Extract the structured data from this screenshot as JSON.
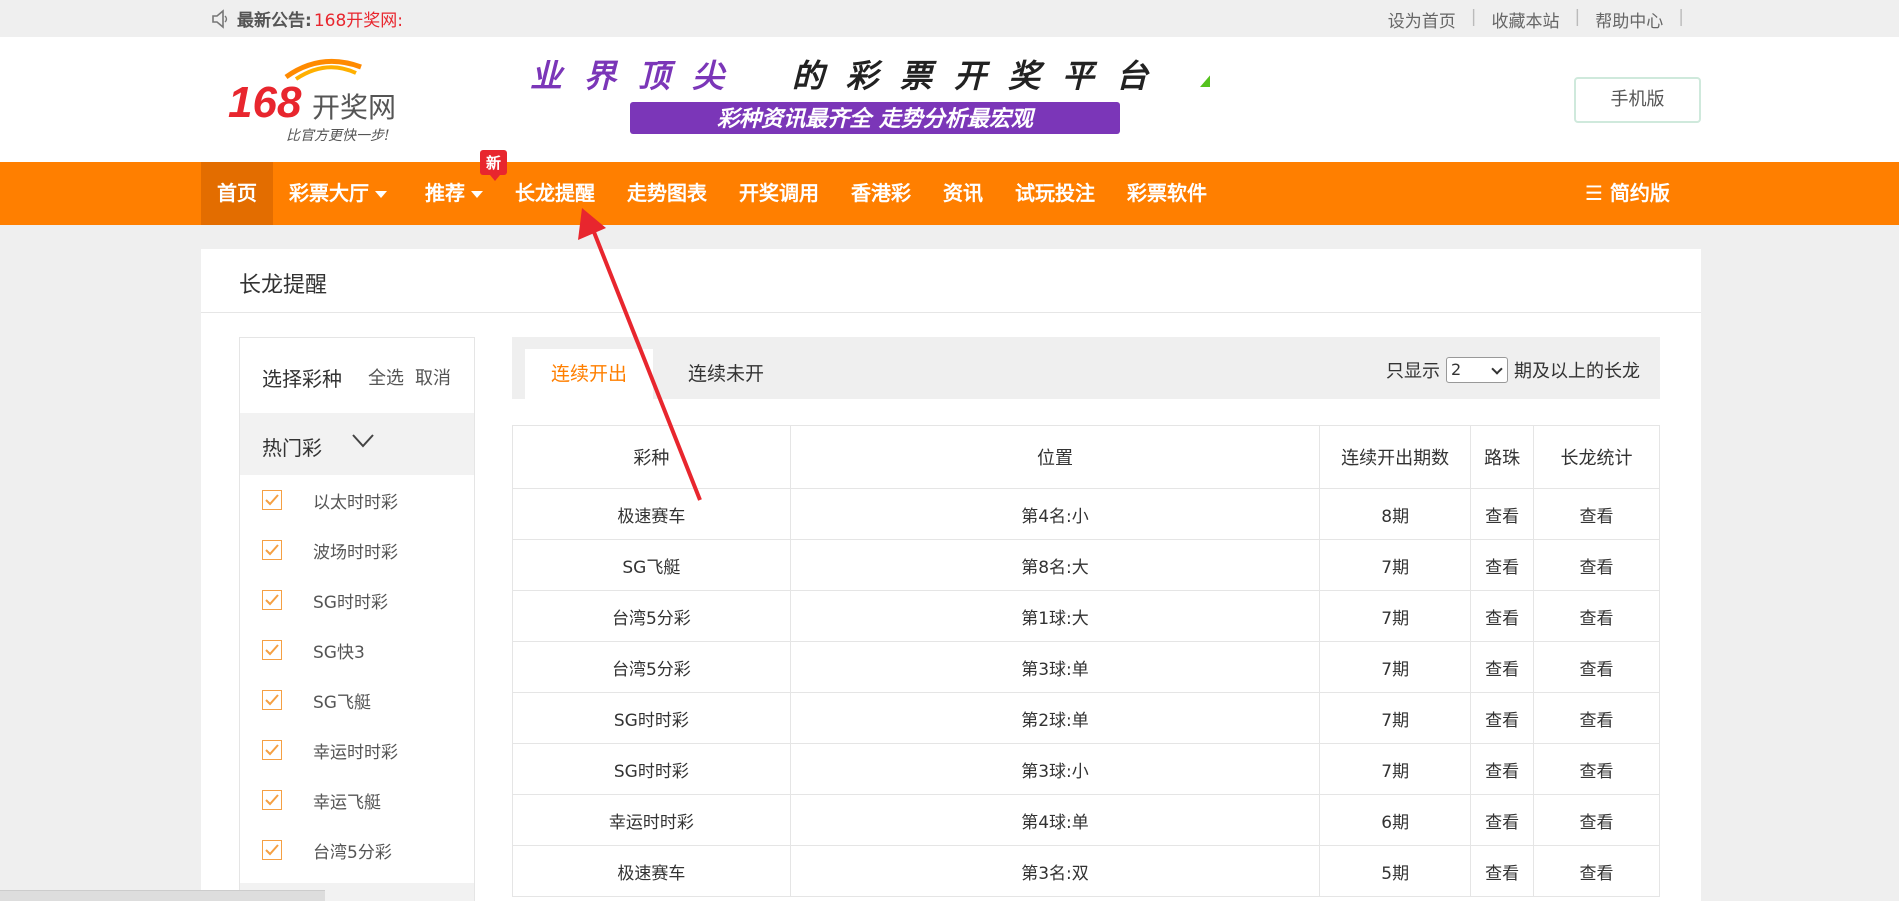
{
  "topbar": {
    "notice_label": "最新公告:",
    "notice_text": "168开奖网:",
    "links": [
      "设为首页",
      "收藏本站",
      "帮助中心"
    ]
  },
  "header": {
    "logo_text": "168开奖网",
    "logo_slogan": "比官方更快一步!",
    "banner_line1": "业界顶尖的彩票开奖平台",
    "banner_line2": "彩种资讯最齐全  走势分析最宏观",
    "mobile_label": "手机版"
  },
  "nav": {
    "items": [
      "首页",
      "彩票大厅",
      "推荐",
      "长龙提醒",
      "走势图表",
      "开奖调用",
      "香港彩",
      "资讯",
      "试玩投注",
      "彩票软件"
    ],
    "new_badge": "新",
    "simple_label": "☰ 简约版"
  },
  "page": {
    "title": "长龙提醒"
  },
  "sidebar": {
    "title": "选择彩种",
    "select_all": "全选",
    "cancel": "取消",
    "group": "热门彩",
    "games": [
      "以太时时彩",
      "波场时时彩",
      "SG时时彩",
      "SG快3",
      "SG飞艇",
      "幸运时时彩",
      "幸运飞艇",
      "台湾5分彩"
    ]
  },
  "tabs": {
    "t1": "连续开出",
    "t2": "连续未开",
    "filter_prefix": "只显示",
    "filter_value": "2",
    "filter_suffix": "期及以上的长龙"
  },
  "table": {
    "headers": [
      "彩种",
      "位置",
      "连续开出期数",
      "路珠",
      "长龙统计"
    ],
    "rows": [
      {
        "game": "极速赛车",
        "pos": "第4名:小",
        "count": "8期",
        "a": "查看",
        "b": "查看"
      },
      {
        "game": "SG飞艇",
        "pos": "第8名:大",
        "count": "7期",
        "a": "查看",
        "b": "查看"
      },
      {
        "game": "台湾5分彩",
        "pos": "第1球:大",
        "count": "7期",
        "a": "查看",
        "b": "查看"
      },
      {
        "game": "台湾5分彩",
        "pos": "第3球:单",
        "count": "7期",
        "a": "查看",
        "b": "查看"
      },
      {
        "game": "SG时时彩",
        "pos": "第2球:单",
        "count": "7期",
        "a": "查看",
        "b": "查看"
      },
      {
        "game": "SG时时彩",
        "pos": "第3球:小",
        "count": "7期",
        "a": "查看",
        "b": "查看"
      },
      {
        "game": "幸运时时彩",
        "pos": "第4球:单",
        "count": "6期",
        "a": "查看",
        "b": "查看"
      },
      {
        "game": "极速赛车",
        "pos": "第3名:双",
        "count": "5期",
        "a": "查看",
        "b": "查看"
      }
    ]
  },
  "colors": {
    "brand": "#ff7f00",
    "nav_active": "#e36d00",
    "notice": "#e8262e",
    "annotation_arrow": "#e8262e"
  }
}
